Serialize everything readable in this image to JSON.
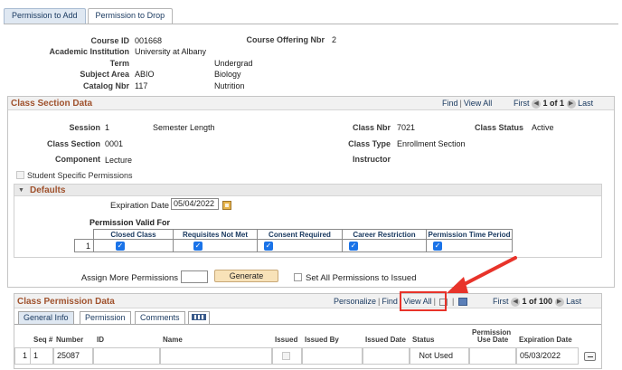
{
  "tabs": {
    "add": "Permission to Add",
    "drop": "Permission to Drop"
  },
  "course": {
    "course_id_label": "Course ID",
    "course_id": "001668",
    "offering_nbr_label": "Course Offering Nbr",
    "offering_nbr": "2",
    "institution_label": "Academic Institution",
    "institution": "University at Albany",
    "term_label": "Term",
    "term": "Undergrad",
    "subject_label": "Subject Area",
    "subject_code": "ABIO",
    "subject_name": "Biology",
    "catalog_label": "Catalog Nbr",
    "catalog_nbr": "117",
    "catalog_name": "Nutrition"
  },
  "class_section": {
    "title": "Class Section Data",
    "nav": {
      "find": "Find",
      "view_all": "View All",
      "first": "First",
      "range": "1 of 1",
      "last": "Last"
    },
    "session_label": "Session",
    "session": "1",
    "session_desc": "Semester Length",
    "class_nbr_label": "Class Nbr",
    "class_nbr": "7021",
    "class_status_label": "Class Status",
    "class_status": "Active",
    "section_label": "Class Section",
    "section": "0001",
    "class_type_label": "Class Type",
    "class_type": "Enrollment Section",
    "component_label": "Component",
    "component": "Lecture",
    "instructor_label": "Instructor",
    "student_specific": "Student Specific Permissions"
  },
  "defaults": {
    "title": "Defaults",
    "expiration_label": "Expiration Date",
    "expiration": "05/04/2022",
    "valid_for_label": "Permission Valid For",
    "columns": [
      "Closed Class",
      "Requisites Not Met",
      "Consent Required",
      "Career Restriction",
      "Permission Time Period"
    ],
    "row_num": "1"
  },
  "assign": {
    "label": "Assign More Permissions",
    "generate": "Generate",
    "set_all": "Set All Permissions to Issued"
  },
  "class_permission": {
    "title": "Class Permission Data",
    "nav": {
      "personalize": "Personalize",
      "find": "Find",
      "view_all": "View All",
      "first": "First",
      "range": "1 of 100",
      "last": "Last"
    },
    "subtabs": {
      "general": "General Info",
      "permission": "Permission",
      "comments": "Comments"
    },
    "columns": {
      "seq": "Seq #",
      "number": "Number",
      "id": "ID",
      "name": "Name",
      "issued": "Issued",
      "issued_by": "Issued By",
      "issued_date": "Issued Date",
      "status": "Status",
      "use_date_1": "Permission",
      "use_date_2": "Use Date",
      "expiration": "Expiration Date"
    },
    "row": {
      "rownum": "1",
      "seq": "1",
      "number": "25087",
      "status": "Not Used",
      "expiration": "05/03/2022"
    }
  },
  "colors": {
    "annotation_red": "#e8332a",
    "section_title": "#a0522d",
    "link_blue": "#17375e"
  }
}
